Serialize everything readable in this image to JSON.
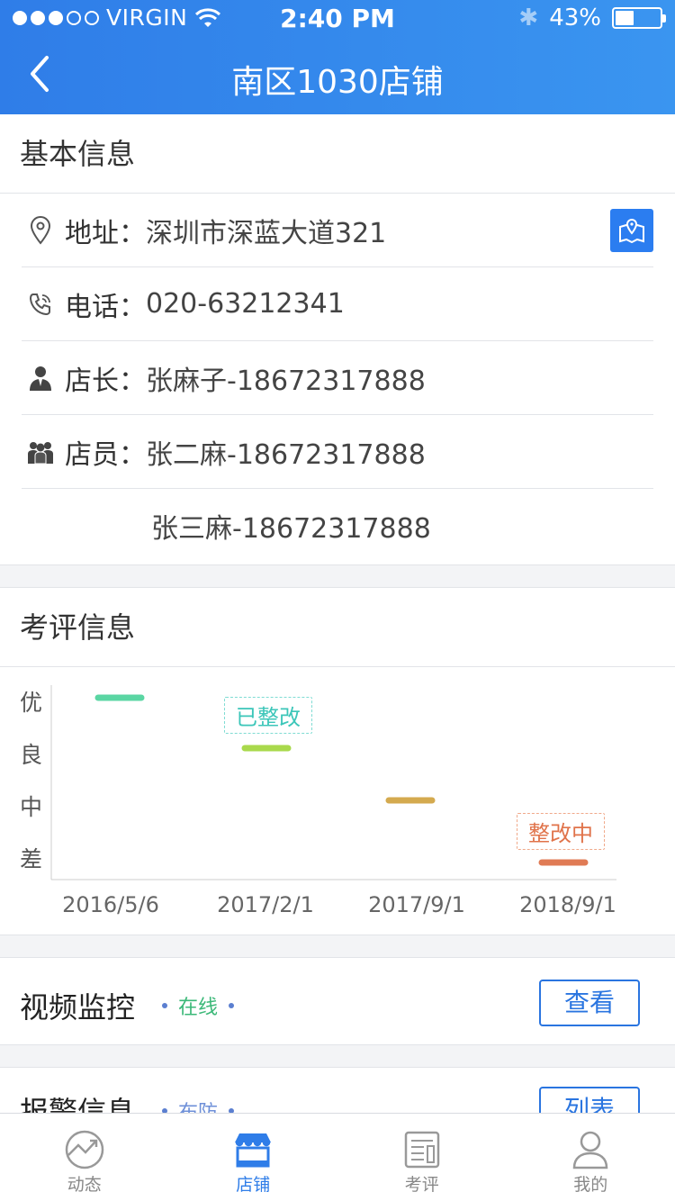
{
  "status_bar": {
    "carrier": "VIRGIN",
    "time": "2:40 PM",
    "battery": "43%",
    "signal_strength": 3
  },
  "nav": {
    "title": "南区1030店铺",
    "back_icon": "chevron-left-icon"
  },
  "basic_info": {
    "title": "基本信息",
    "address": {
      "label": "地址：",
      "value": "深圳市深蓝大道321"
    },
    "phone": {
      "label": "电话：",
      "value": "020-63212341"
    },
    "manager": {
      "label": "店长：",
      "value": "张麻子-18672317888"
    },
    "staff": {
      "label": "店员：",
      "values": [
        "张二麻-18672317888",
        "张三麻-18672317888"
      ]
    }
  },
  "evaluation": {
    "title": "考评信息",
    "badges": {
      "fixed": "已整改",
      "fixing": "整改中"
    },
    "colors": {
      "excellent": "#5ad6a3",
      "good": "#a9d94c",
      "medium": "#d4aa4f",
      "poor": "#e07b55",
      "badge_fixed": "#3cc6b9",
      "badge_fixing": "#e0734a"
    }
  },
  "chart_data": {
    "type": "scatter",
    "categories": [
      "2016/5/6",
      "2017/2/1",
      "2017/9/1",
      "2018/9/1"
    ],
    "y_levels": [
      "优",
      "良",
      "中",
      "差"
    ],
    "values": [
      "优",
      "良",
      "中",
      "差"
    ],
    "annotations": [
      {
        "category": "2017/2/1",
        "text": "已整改"
      },
      {
        "category": "2018/9/1",
        "text": "整改中"
      }
    ],
    "title": "",
    "xlabel": "",
    "ylabel": ""
  },
  "video": {
    "title": "视频监控",
    "status": "在线",
    "status_color": "#3bb878",
    "button": "查看"
  },
  "alarm": {
    "title": "报警信息",
    "status": "布防",
    "button": "列表"
  },
  "tabbar": {
    "items": [
      {
        "label": "动态",
        "icon": "trend-icon"
      },
      {
        "label": "店铺",
        "icon": "store-icon"
      },
      {
        "label": "考评",
        "icon": "report-icon"
      },
      {
        "label": "我的",
        "icon": "user-icon"
      }
    ],
    "active_index": 1
  }
}
